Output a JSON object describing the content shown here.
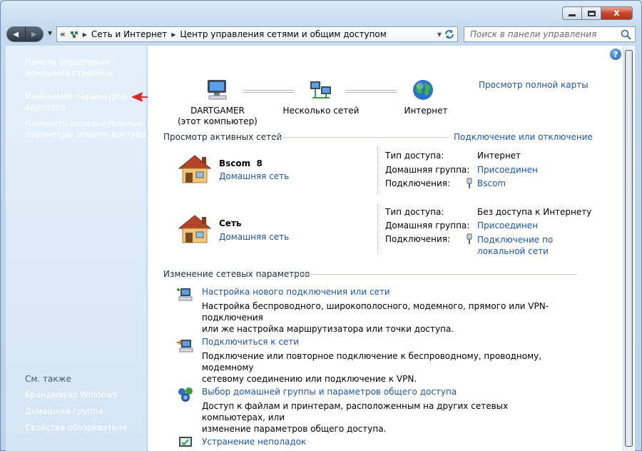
{
  "titlebar": {
    "minimize": "–",
    "maximize": "□",
    "close": "x"
  },
  "nav": {
    "back_glyph": "◀",
    "forward_glyph": "▶",
    "recent_glyph": "▼"
  },
  "address": {
    "overflow": "«",
    "sep": "▶",
    "crumbs": [
      "Сеть и Интернет",
      "Центр управления сетями и общим доступом"
    ],
    "dropdown": "▼",
    "refresh_icon": "refresh-icon"
  },
  "search": {
    "placeholder": "Поиск в панели управления",
    "icon": "search-icon"
  },
  "sidebar": {
    "links": [
      {
        "line1": "Панель управления -",
        "line2": "домашняя страница"
      },
      {
        "line1": "Изменение параметров",
        "line2": "адаптера"
      },
      {
        "line1": "Изменить дополнительные",
        "line2": "параметры общего доступа"
      }
    ],
    "see_also": "См. также",
    "see_also_links": [
      "Брандмауэр Windows",
      "Домашняя группа",
      "Свойства обозревателя"
    ]
  },
  "map": {
    "computer_name": "DARTGAMER",
    "computer_sub": "(этот компьютер)",
    "multi": "Несколько сетей",
    "internet": "Интернет",
    "full_map": "Просмотр полной карты"
  },
  "active": {
    "header": "Просмотр активных сетей",
    "connect_link": "Подключение или отключение",
    "networks": [
      {
        "name": "Bscom  8",
        "type": "Домашняя сеть",
        "access_label": "Тип доступа:",
        "access_value": "Интернет",
        "group_label": "Домашняя группа:",
        "group_value": "Присоединен",
        "conn_label": "Подключения:",
        "conn_line1": "Bscom",
        "conn_line2": ""
      },
      {
        "name": "Сеть",
        "type": "Домашняя сеть",
        "access_label": "Тип доступа:",
        "access_value": "Без доступа к Интернету",
        "group_label": "Домашняя группа:",
        "group_value": "Присоединен",
        "conn_label": "Подключения:",
        "conn_line1": "Подключение по",
        "conn_line2": "локальной сети"
      }
    ]
  },
  "change": {
    "header": "Изменение сетевых параметров",
    "tasks": [
      {
        "title": "Настройка нового подключения или сети",
        "line1": "Настройка беспроводного, широкополосного, модемного, прямого или VPN-подключения",
        "line2": "или же настройка маршрутизатора или точки доступа."
      },
      {
        "title": "Подключиться к сети",
        "line1": "Подключение или повторное подключение к беспроводному, проводному, модемному",
        "line2": "сетевому соединению или подключение к VPN."
      },
      {
        "title": "Выбор домашней группы и параметров общего доступа",
        "line1": "Доступ к файлам и принтерам, расположенным на других сетевых компьютерах, или",
        "line2": "изменение параметров общего доступа."
      },
      {
        "title": "Устранение неполадок",
        "line1": "",
        "line2": ""
      }
    ]
  },
  "help": "?",
  "colors": {
    "link": "#1e55a8",
    "annotation_arrow": "#e0262b",
    "sidebar_bg": "#dbe9f7"
  }
}
